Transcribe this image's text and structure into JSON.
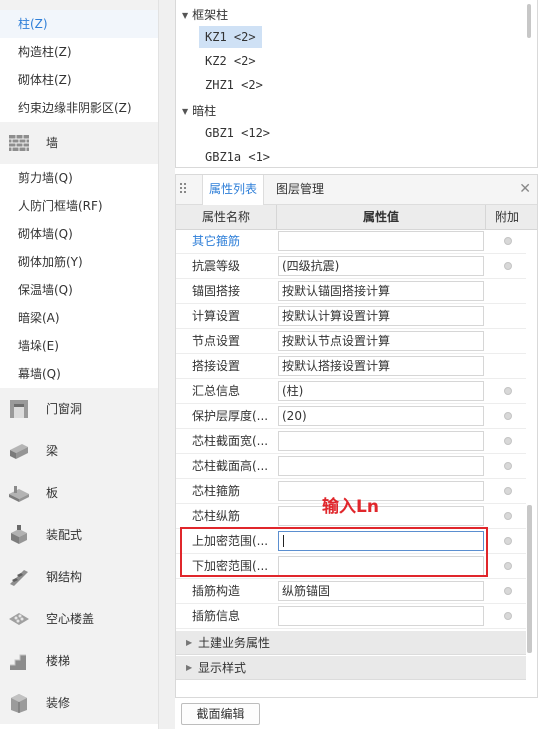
{
  "left_nav": {
    "items": [
      {
        "label": "柱(Z)",
        "selected": true
      },
      {
        "label": "构造柱(Z)"
      },
      {
        "label": "砌体柱(Z)"
      },
      {
        "label": "约束边缘非阴影区(Z)"
      }
    ],
    "wall": {
      "label": "墙",
      "icon": "brick-wall-icon",
      "items": [
        {
          "label": "剪力墙(Q)"
        },
        {
          "label": "人防门框墙(RF)"
        },
        {
          "label": "砌体墙(Q)"
        },
        {
          "label": "砌体加筋(Y)"
        },
        {
          "label": "保温墙(Q)"
        },
        {
          "label": "暗梁(A)"
        },
        {
          "label": "墙垛(E)"
        },
        {
          "label": "幕墙(Q)"
        }
      ]
    },
    "categories": [
      {
        "label": "门窗洞",
        "icon": "door-window-icon"
      },
      {
        "label": "梁",
        "icon": "beam-icon"
      },
      {
        "label": "板",
        "icon": "slab-icon"
      },
      {
        "label": "装配式",
        "icon": "prefab-icon"
      },
      {
        "label": "钢结构",
        "icon": "steel-structure-icon"
      },
      {
        "label": "空心楼盖",
        "icon": "hollow-floor-icon"
      },
      {
        "label": "楼梯",
        "icon": "stairs-icon"
      },
      {
        "label": "装修",
        "icon": "decoration-icon"
      }
    ]
  },
  "tree": {
    "groups": [
      {
        "label": "框架柱",
        "nodes": [
          {
            "label": "KZ1 <2>",
            "selected": true
          },
          {
            "label": "KZ2 <2>"
          },
          {
            "label": "ZHZ1 <2>"
          }
        ]
      },
      {
        "label": "暗柱",
        "nodes": [
          {
            "label": "GBZ1 <12>"
          },
          {
            "label": "GBZ1a <1>"
          }
        ]
      }
    ]
  },
  "props": {
    "tabs": [
      {
        "label": "属性列表",
        "active": true
      },
      {
        "label": "图层管理",
        "active": false
      }
    ],
    "close_icon": "close-icon",
    "columns": {
      "name": "属性名称",
      "value": "属性值",
      "extra": "附加"
    },
    "rows": [
      {
        "name": "其它箍筋",
        "value": "",
        "blue": true,
        "radio": true
      },
      {
        "name": "抗震等级",
        "value": "(四级抗震)",
        "radio": true
      },
      {
        "name": "锚固搭接",
        "value": "按默认锚固搭接计算",
        "radio": false
      },
      {
        "name": "计算设置",
        "value": "按默认计算设置计算",
        "radio": false
      },
      {
        "name": "节点设置",
        "value": "按默认节点设置计算",
        "radio": false
      },
      {
        "name": "搭接设置",
        "value": "按默认搭接设置计算",
        "radio": false
      },
      {
        "name": "汇总信息",
        "value": "(柱)",
        "radio": true
      },
      {
        "name": "保护层厚度(...",
        "value": "(20)",
        "radio": true
      },
      {
        "name": "芯柱截面宽(...",
        "value": "",
        "radio": true
      },
      {
        "name": "芯柱截面高(...",
        "value": "",
        "radio": true
      },
      {
        "name": "芯柱箍筋",
        "value": "",
        "radio": true
      },
      {
        "name": "芯柱纵筋",
        "value": "",
        "radio": true
      },
      {
        "name": "上加密范围(...",
        "value": "",
        "radio": true,
        "focused": true
      },
      {
        "name": "下加密范围(...",
        "value": "",
        "radio": true
      },
      {
        "name": "插筋构造",
        "value": "纵筋锚固",
        "radio": true
      },
      {
        "name": "插筋信息",
        "value": "",
        "radio": true
      }
    ],
    "sections": [
      {
        "label": "土建业务属性"
      },
      {
        "label": "显示样式"
      }
    ]
  },
  "annotation": {
    "text": "输入Ln",
    "color": "#e0262b"
  },
  "footer": {
    "section_edit": "截面编辑"
  },
  "colors": {
    "accent": "#2f7fd8",
    "selection_bg": "#cfe1f5",
    "annotation_red": "#e0262b"
  }
}
